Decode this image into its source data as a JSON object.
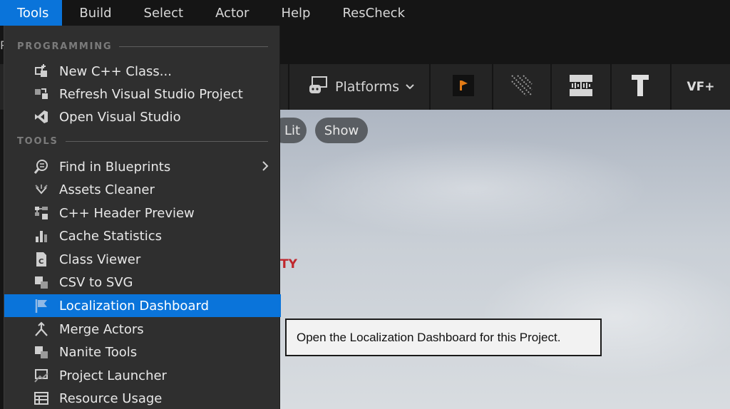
{
  "menubar": {
    "items": [
      "Tools",
      "Build",
      "Select",
      "Actor",
      "Help",
      "ResCheck"
    ],
    "active_index": 0
  },
  "toolbar": {
    "platforms_label": "Platforms",
    "vf_label": "VF+"
  },
  "viewport": {
    "lit_label": "Lit",
    "show_label": "Show",
    "warning_fragment": "TY",
    "left_ghost": "P"
  },
  "tools_menu": {
    "programming_header": "PROGRAMMING",
    "tools_header": "TOOLS",
    "programming_items": [
      {
        "label": "New C++ Class...",
        "icon": "new-cpp-class-icon"
      },
      {
        "label": "Refresh Visual Studio Project",
        "icon": "refresh-project-icon"
      },
      {
        "label": "Open Visual Studio",
        "icon": "visual-studio-icon"
      }
    ],
    "tools_items": [
      {
        "label": "Find in Blueprints",
        "icon": "find-in-blueprints-icon",
        "submenu": true
      },
      {
        "label": "Assets Cleaner",
        "icon": "assets-cleaner-icon"
      },
      {
        "label": "C++ Header Preview",
        "icon": "header-preview-icon"
      },
      {
        "label": "Cache Statistics",
        "icon": "cache-statistics-icon"
      },
      {
        "label": "Class Viewer",
        "icon": "class-viewer-icon"
      },
      {
        "label": "CSV to SVG",
        "icon": "csv-to-svg-icon"
      },
      {
        "label": "Localization Dashboard",
        "icon": "flag-icon",
        "highlighted": true
      },
      {
        "label": "Merge Actors",
        "icon": "merge-actors-icon"
      },
      {
        "label": "Nanite Tools",
        "icon": "nanite-tools-icon"
      },
      {
        "label": "Project Launcher",
        "icon": "project-launcher-icon"
      },
      {
        "label": "Resource Usage",
        "icon": "resource-usage-icon"
      }
    ]
  },
  "tooltip": {
    "text": "Open the Localization Dashboard for this Project."
  },
  "colors": {
    "accent": "#0a74da",
    "menu_bg": "#2f2f2f",
    "warning_text": "#c0272d"
  }
}
